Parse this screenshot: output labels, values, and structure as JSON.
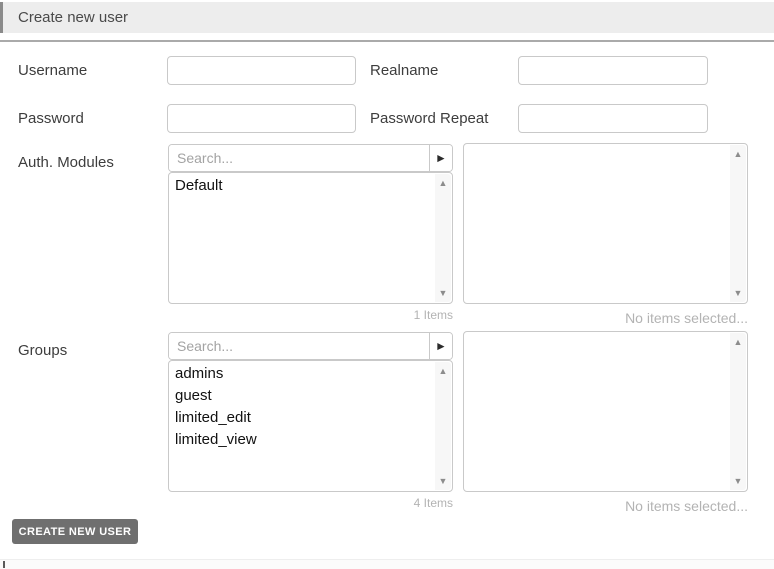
{
  "header": {
    "title": "Create new user"
  },
  "fields": {
    "username": {
      "label": "Username",
      "value": ""
    },
    "realname": {
      "label": "Realname",
      "value": ""
    },
    "password": {
      "label": "Password",
      "value": ""
    },
    "password_repeat": {
      "label": "Password Repeat",
      "value": ""
    }
  },
  "auth_modules": {
    "label": "Auth. Modules",
    "search_placeholder": "Search...",
    "available_items": [
      "Default"
    ],
    "count_text": "1 Items",
    "selected_items": [],
    "selected_empty_text": "No items selected..."
  },
  "groups": {
    "label": "Groups",
    "search_placeholder": "Search...",
    "available_items": [
      "admins",
      "guest",
      "limited_edit",
      "limited_view"
    ],
    "count_text": "4 Items",
    "selected_items": [],
    "selected_empty_text": "No items selected..."
  },
  "actions": {
    "create_button": "CREATE NEW USER"
  },
  "icons": {
    "add_arrow": "►",
    "scroll_up": "▲",
    "scroll_down": "▼"
  },
  "colors": {
    "header_bg": "#ededed",
    "header_accent": "#8a8a8a",
    "divider": "#aaaaaa",
    "border": "#c9c9c9",
    "button_bg": "#6f6f6f",
    "button_text": "#ffffff",
    "muted_text": "#b3b3b3"
  }
}
